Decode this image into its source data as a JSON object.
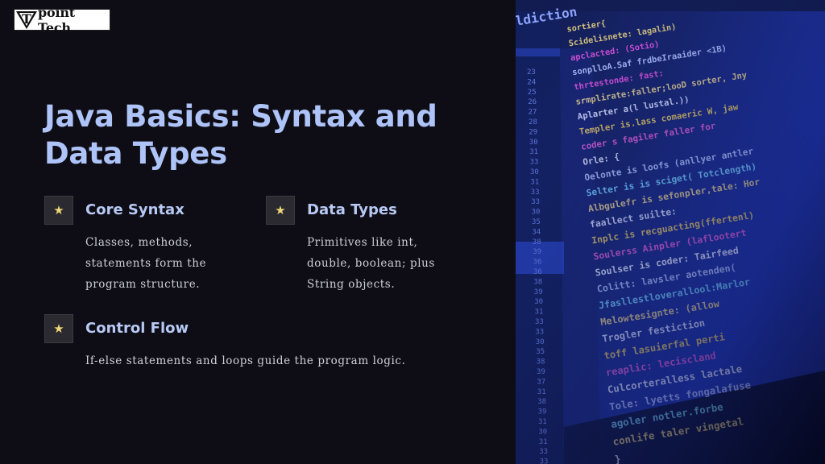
{
  "logo": {
    "mark_letter": "T",
    "text": "point Tech"
  },
  "title": "Java Basics: Syntax and Data Types",
  "features": [
    {
      "icon": "star-icon",
      "heading": "Core Syntax",
      "description": "Classes, methods, statements form the program structure."
    },
    {
      "icon": "star-icon",
      "heading": "Data Types",
      "description": "Primitives like int, double, boolean; plus String objects."
    },
    {
      "icon": "star-icon",
      "heading": "Control Flow",
      "description": "If-else statements and loops guide the program logic."
    }
  ],
  "photo": {
    "code_lines": [
      "ldiction",
      "sortier{",
      "Scidelisnete: lagalin)",
      "apclacted: (Sotio)",
      "sonplloA.Saf frdbeIraaider <1B)",
      "thrtestonde: fast:",
      "srmplirate:faller;looD sorter, Jny",
      "Aplarter a(l lustal.))",
      "Templer is.lass comaeric W, jaw",
      "coder s fagiler faller for",
      "Orle: {",
      "Oelonte is loofs (anllyer antler",
      "Selter is is sciget( Totclength)",
      "Albgulefr is sefonpler,tale: Hor",
      "faallect suilte:",
      "Inplc is recguacting(ffertenl)",
      "Soulerss Ainpler (laflootert",
      "Soulser is coder: Tairfeed",
      "Colitt: lavsler aotenden(",
      "Jfasllestloverallool:Marlor",
      "Melowtesignte: (allow",
      "Trogler festiction",
      "toff lasuierfal perti",
      "reaplic: leciscland",
      "Culcorteralless lactale",
      "Tole: lyetts fongalafuse",
      "agoler notler.forbe",
      "conlife taler vingetal",
      "}",
      "}"
    ],
    "line_numbers": [
      "23",
      "24",
      "25",
      "26",
      "27",
      "28",
      "29",
      "30",
      "31",
      "33",
      "30",
      "31",
      "33",
      "33",
      "30",
      "35",
      "34",
      "38",
      "39",
      "36",
      "36",
      "38",
      "39",
      "30",
      "31",
      "33",
      "33",
      "30",
      "35",
      "38",
      "39",
      "37",
      "31",
      "38",
      "39",
      "31",
      "30",
      "31",
      "33",
      "33",
      "38"
    ]
  }
}
